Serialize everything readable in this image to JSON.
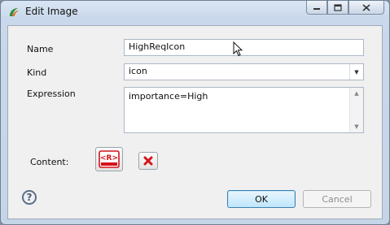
{
  "window": {
    "title": "Edit Image"
  },
  "form": {
    "name_label": "Name",
    "name_value": "HighReqIcon",
    "kind_label": "Kind",
    "kind_value": "icon",
    "expression_label": "Expression",
    "expression_value": "importance=High",
    "content_label": "Content:",
    "content_icon_text": "<R>"
  },
  "buttons": {
    "help": "?",
    "ok": "OK",
    "cancel": "Cancel"
  },
  "icons": {
    "app": "app-icon",
    "minimize": "minimize-icon",
    "maximize": "maximize-icon",
    "close": "close-icon",
    "content": "requirement-image-icon",
    "delete": "delete-x-icon",
    "combo": "chevron-down-icon"
  },
  "colors": {
    "content_icon": "#d4141c",
    "delete_icon": "#d4141c",
    "ok_border": "#3c7fb1"
  }
}
